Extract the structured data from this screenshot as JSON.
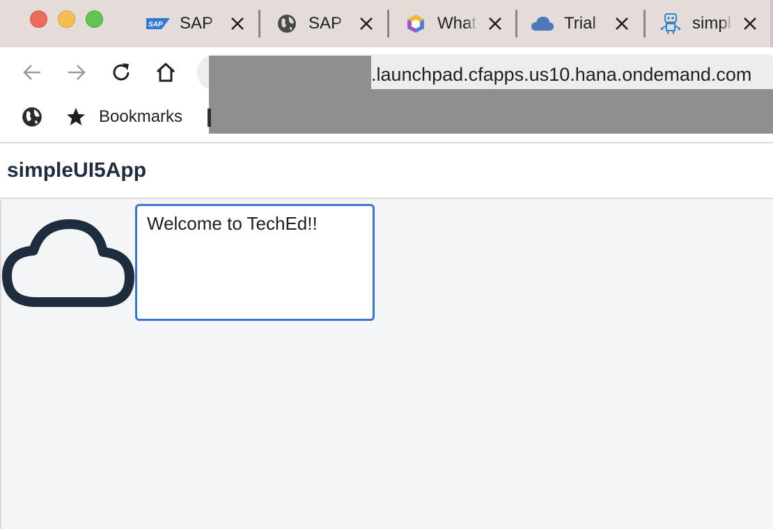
{
  "window": {
    "controls": [
      "close",
      "minimize",
      "maximize"
    ]
  },
  "tabs": [
    {
      "title": "SAP",
      "icon": "sap-logo-icon"
    },
    {
      "title": "SAP",
      "icon": "globe-icon"
    },
    {
      "title": "What",
      "icon": "hexagon-logo-icon"
    },
    {
      "title": "Trial",
      "icon": "cloud-icon"
    },
    {
      "title": "simpl",
      "icon": "robot-icon"
    }
  ],
  "toolbar": {
    "url": ".launchpad.cfapps.us10.hana.ondemand.com"
  },
  "bookmarks": {
    "label": "Bookmarks"
  },
  "app": {
    "title": "simpleUI5App"
  },
  "content": {
    "welcome_text": "Welcome to TechEd!!",
    "icon": "cloud-icon"
  },
  "colors": {
    "tabstrip_bg": "#e4dcd8",
    "accent_border": "#3a75d6",
    "title_color": "#1d2d3e",
    "content_bg": "#f4f5f7"
  }
}
